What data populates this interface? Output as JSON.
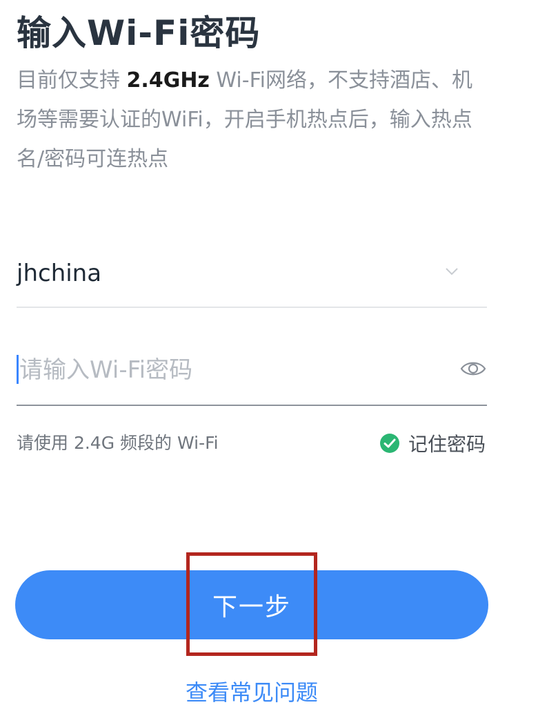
{
  "header": {
    "title": "输入Wi-Fi密码"
  },
  "description": {
    "prefix": "目前仅支持 ",
    "highlight": "2.4GHz",
    "suffix": " Wi-Fi网络，不支持酒店、机场等需要认证的WiFi，开启手机热点后，输入热点名/密码可连热点"
  },
  "ssid": {
    "value": "jhchina",
    "dropdown_icon": "chevron-down-icon"
  },
  "password": {
    "placeholder": "请输入Wi-Fi密码",
    "value": "",
    "toggle_icon": "eye-icon"
  },
  "hint_text": "请使用 2.4G 频段的 Wi-Fi",
  "remember": {
    "label": "记住密码",
    "checked": true,
    "icon": "check-circle-icon",
    "color": "#2bb673"
  },
  "next_button": {
    "label": "下一步",
    "color": "#3d8bf7"
  },
  "faq_link": "查看常见问题",
  "highlight_color": "#b3261e"
}
